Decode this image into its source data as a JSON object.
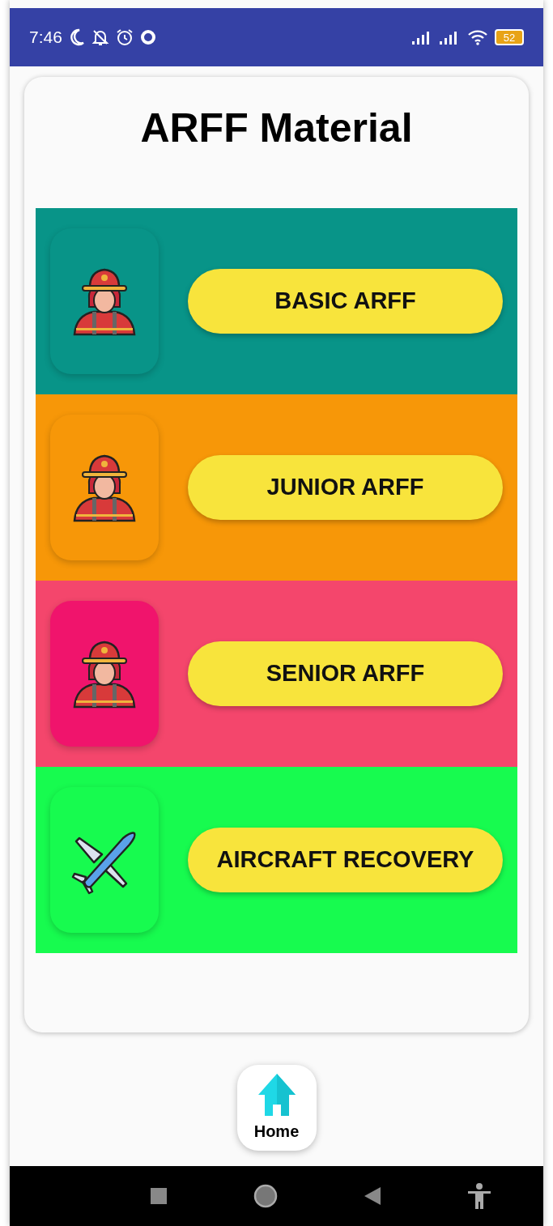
{
  "status_bar": {
    "time": "7:46",
    "battery": "52"
  },
  "title": "ARFF Material",
  "rows": [
    {
      "label": "BASIC ARFF",
      "kind": "firefighter",
      "color": "#089488",
      "tile": {
        "color": "#089488"
      }
    },
    {
      "label": "JUNIOR ARFF",
      "kind": "firefighter",
      "color": "#f79708",
      "tile": {
        "color": "#f79708"
      }
    },
    {
      "label": "SENIOR ARFF",
      "kind": "firefighter",
      "color": "#f4466c",
      "tile": {
        "color": "#f0146c"
      }
    },
    {
      "label": "AIRCRAFT RECOVERY",
      "kind": "airplane",
      "color": "#17fb4f",
      "tile": {
        "color": "#17fb4f"
      }
    }
  ],
  "bottom_nav": [
    {
      "label": "Home",
      "selected": true
    }
  ]
}
